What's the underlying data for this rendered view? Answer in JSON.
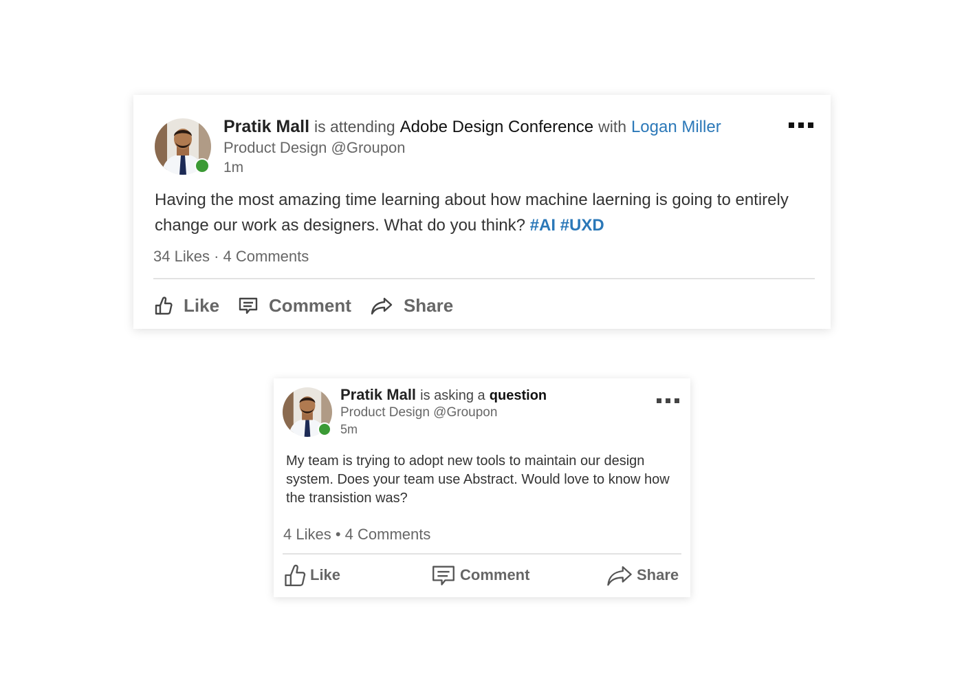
{
  "posts": [
    {
      "author_name": "Pratik Mall",
      "verb": "is attending",
      "event": "Adobe Design Conference",
      "with_word": "with",
      "mention": "Logan Miller",
      "subtitle": "Product Design @Groupon",
      "time": "1m",
      "body": "Having the most amazing time learning about how machine laerning is going to entirely change our work as designers. What do you think?",
      "hashtags": [
        "#AI",
        "#UXD"
      ],
      "stats": {
        "likes": "34 Likes",
        "separator": "·",
        "comments": "4 Comments"
      },
      "actions": {
        "like": "Like",
        "comment": "Comment",
        "share": "Share"
      },
      "online": true,
      "icons": {
        "more": "more-horizontal-icon",
        "like": "thumbs-up-icon",
        "comment": "comment-icon",
        "share": "share-icon"
      }
    },
    {
      "author_name": "Pratik Mall",
      "verb": "is asking a",
      "topic": "question",
      "subtitle": "Product Design @Groupon",
      "time": "5m",
      "body": "My team is trying to adopt new tools to maintain our design system. Does your team use Abstract. Would love to know how the transistion was?",
      "stats": {
        "likes": "4 Likes",
        "separator": "•",
        "comments": "4 Comments"
      },
      "actions": {
        "like": "Like",
        "comment": "Comment",
        "share": "Share"
      },
      "online": true,
      "icons": {
        "more": "more-horizontal-icon",
        "like": "thumbs-up-icon",
        "comment": "comment-icon",
        "share": "share-icon"
      }
    }
  ],
  "colors": {
    "link": "#2b78b8",
    "online": "#3b9a35",
    "muted_text": "#666666",
    "divider": "#e2e2e2"
  }
}
